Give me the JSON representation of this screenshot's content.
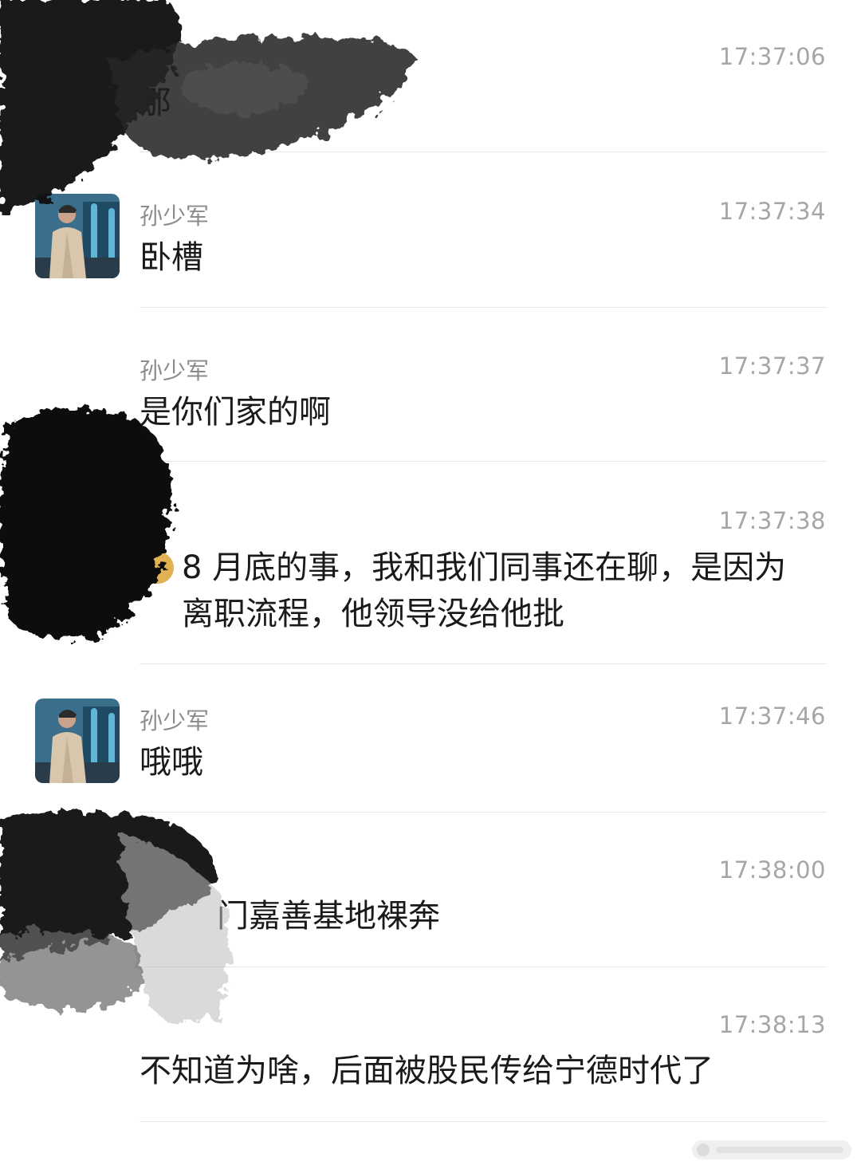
{
  "messages": [
    {
      "name": "",
      "time": "17:37:06",
      "text": "那",
      "avatar": false
    },
    {
      "name": "孙少军",
      "time": "17:37:34",
      "text": "卧槽",
      "avatar": true
    },
    {
      "name": "孙少军",
      "time": "17:37:37",
      "text": "是你们家的啊",
      "avatar": false
    },
    {
      "name": "",
      "time": "17:37:38",
      "text": "8 月底的事，我和我们同事还在聊，是因为离职流程，他领导没给他批",
      "avatar": false
    },
    {
      "name": "孙少军",
      "time": "17:37:46",
      "text": "哦哦",
      "avatar": true
    },
    {
      "name": "",
      "time": "17:38:00",
      "text": "门嘉善基地裸奔",
      "avatar": false
    },
    {
      "name": "",
      "time": "17:38:13",
      "text": "不知道为啥，后面被股民传给宁德时代了",
      "avatar": false
    }
  ],
  "icons": {
    "avatar": "person-photo-avatar-icon",
    "emoji": "emoji-icon"
  },
  "colors": {
    "background": "#ffffff",
    "name": "#8c8c8c",
    "time": "#a6a6a6",
    "text": "#1a1a1a",
    "divider": "#e6e6e6",
    "redaction": "#111111"
  }
}
